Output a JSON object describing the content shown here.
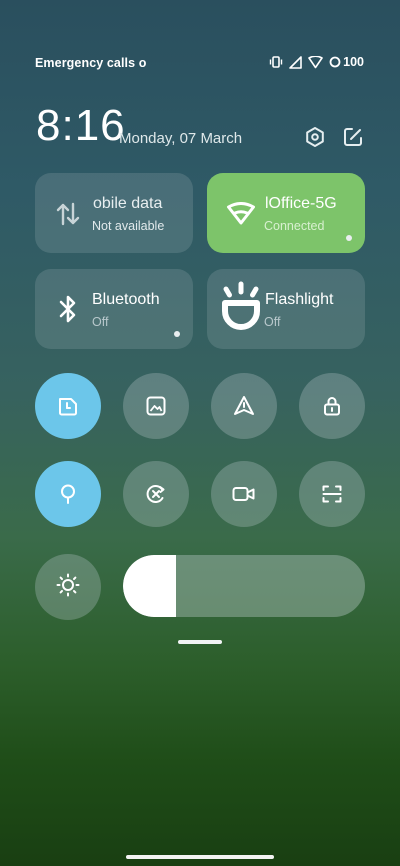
{
  "status_bar": {
    "left_text": "Emergency calls o",
    "battery": "100"
  },
  "header": {
    "time": "8:16",
    "date": "Monday, 07 March"
  },
  "tiles": {
    "mobile_data": {
      "title": "obile data",
      "subtitle": "Not available",
      "state": "off"
    },
    "wifi": {
      "title": "lOffice-5G",
      "subtitle": "Connected",
      "state": "on"
    },
    "bluetooth": {
      "title": "Bluetooth",
      "subtitle": "Off",
      "state": "off"
    },
    "flashlight": {
      "title": "Flashlight",
      "subtitle": "Off",
      "state": "off"
    }
  },
  "toggles_row1": [
    {
      "icon": "auto-rotate-icon",
      "on": true
    },
    {
      "icon": "screenshot-icon",
      "on": false
    },
    {
      "icon": "location-icon",
      "on": false
    },
    {
      "icon": "lock-icon",
      "on": false
    }
  ],
  "toggles_row2": [
    {
      "icon": "bulb-icon",
      "on": true
    },
    {
      "icon": "airplane-mode-icon",
      "on": false
    },
    {
      "icon": "screen-record-icon",
      "on": false
    },
    {
      "icon": "scanner-icon",
      "on": false
    }
  ],
  "brightness": {
    "level_fraction": 0.22
  },
  "colors": {
    "accent_on": "#6cc6ea",
    "wifi_on": "#7dc46a"
  }
}
